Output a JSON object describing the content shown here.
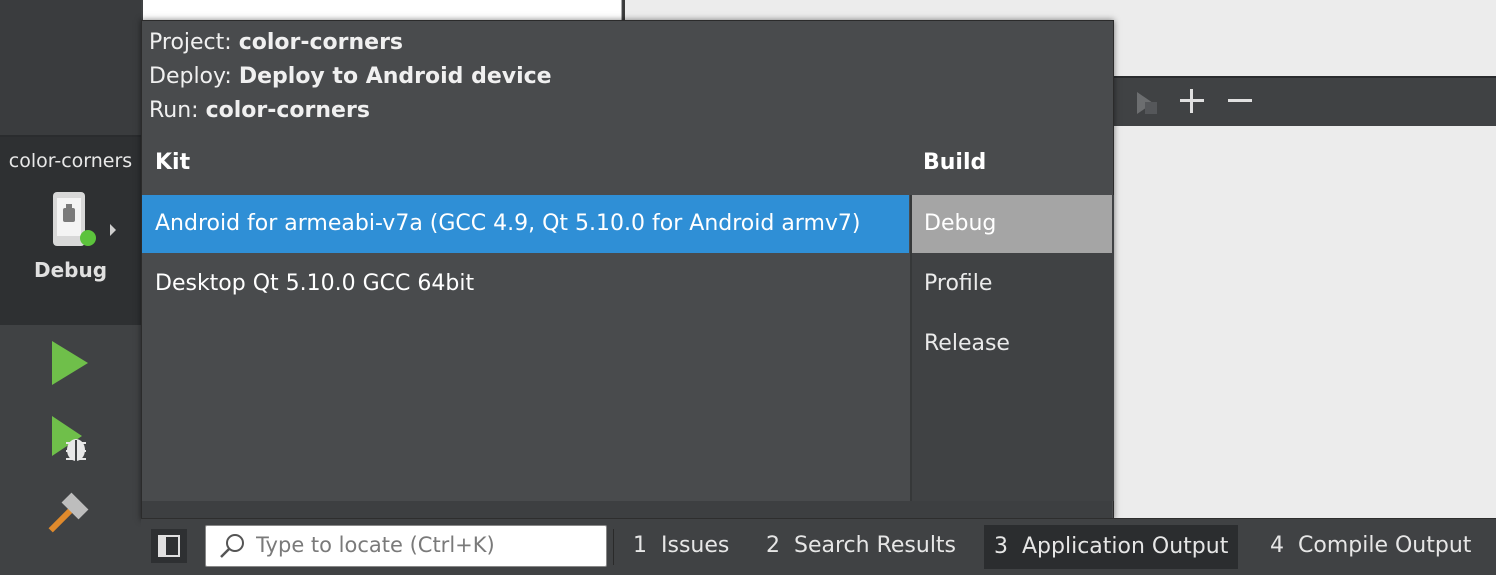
{
  "popup": {
    "project_label": "Project: ",
    "project_value": "color-corners",
    "deploy_label": "Deploy: ",
    "deploy_value": "Deploy to Android device",
    "run_label": "Run: ",
    "run_value": "color-corners",
    "kit_header": "Kit",
    "build_header": "Build",
    "kits": [
      {
        "label": "Android for armeabi-v7a (GCC 4.9, Qt 5.10.0 for Android armv7)",
        "selected": true
      },
      {
        "label": "Desktop Qt 5.10.0 GCC 64bit",
        "selected": false
      }
    ],
    "builds": [
      {
        "label": "Debug",
        "selected": true
      },
      {
        "label": "Profile",
        "selected": false
      },
      {
        "label": "Release",
        "selected": false
      }
    ]
  },
  "target_selector": {
    "project_name": "color-corners",
    "build_mode": "Debug",
    "device_icon": "android-device-icon"
  },
  "tools": [
    "run-icon",
    "debug-run-icon",
    "build-hammer-icon"
  ],
  "status_bar": {
    "locator_placeholder": "Type to locate (Ctrl+K)",
    "tabs": [
      {
        "num": "1",
        "label": "Issues",
        "active": false
      },
      {
        "num": "2",
        "label": "Search Results",
        "active": false
      },
      {
        "num": "3",
        "label": "Application Output",
        "active": true
      },
      {
        "num": "4",
        "label": "Compile Output",
        "active": false
      }
    ]
  },
  "colors": {
    "selection": "#2f8fd6",
    "build_selection": "#a5a5a5",
    "run_green": "#6fbf4a",
    "status_dot": "#5cc33c"
  }
}
